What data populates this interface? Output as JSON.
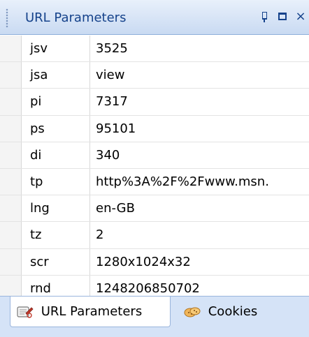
{
  "panel": {
    "title": "URL Parameters",
    "pin_glyph": "pin-icon",
    "maximize_glyph": "maximize-icon",
    "close_glyph": "×"
  },
  "parameters": [
    {
      "key": "jsv",
      "value": "3525"
    },
    {
      "key": "jsa",
      "value": "view"
    },
    {
      "key": "pi",
      "value": "7317"
    },
    {
      "key": "ps",
      "value": "95101"
    },
    {
      "key": "di",
      "value": "340"
    },
    {
      "key": "tp",
      "value": "http%3A%2F%2Fwww.msn."
    },
    {
      "key": "lng",
      "value": "en-GB"
    },
    {
      "key": "tz",
      "value": "2"
    },
    {
      "key": "scr",
      "value": "1280x1024x32"
    },
    {
      "key": "rnd",
      "value": "1248206850702"
    }
  ],
  "tabs": [
    {
      "label": "URL Parameters",
      "icon": "url-parameters-icon",
      "active": true
    },
    {
      "label": "Cookies",
      "icon": "cookies-icon",
      "active": false
    }
  ],
  "colors": {
    "header_text": "#15428b",
    "header_bg": "#c9daf2",
    "tabbar_bg": "#d5e3f7"
  }
}
